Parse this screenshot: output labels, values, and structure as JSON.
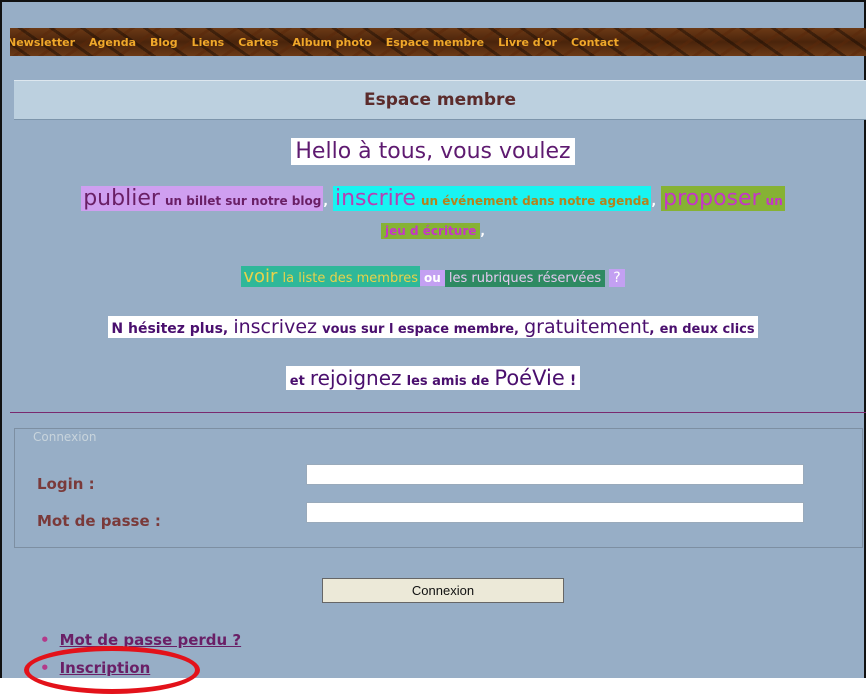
{
  "nav": {
    "items": [
      "Newsletter",
      "Agenda",
      "Blog",
      "Liens",
      "Cartes",
      "Album photo",
      "Espace membre",
      "Livre d'or",
      "Contact"
    ]
  },
  "page_title": "Espace membre",
  "intro": {
    "line1": "Hello à tous,  vous voulez",
    "line2": {
      "publier": "publier",
      "publier_rest": "un billet sur notre blog",
      "sep1": ",",
      "inscrire": "inscrire",
      "inscrire_rest": "un événement dans notre agenda",
      "sep2": ",",
      "proposer": "proposer",
      "proposer_rest": "un",
      "jeu": "jeu d écriture",
      "sep3": ","
    },
    "line3": {
      "voir": "voir",
      "voir_rest": "la liste des membres",
      "ou": "ou",
      "rubriques": "les rubriques réservées",
      "q": "?"
    },
    "line4": {
      "a": "N hésitez plus,",
      "b": "inscrivez",
      "c": "vous sur l espace membre,",
      "d": "gratuitement",
      "e": ",",
      "f": "en deux clics"
    },
    "line5": {
      "a": "et",
      "b": "rejoignez",
      "c": "les amis de",
      "d": "PoéVie",
      "e": "!"
    }
  },
  "login_form": {
    "legend": "Connexion",
    "login_label": "Login :",
    "login_value": "",
    "password_label": "Mot de passe :",
    "password_value": "",
    "submit_label": "Connexion"
  },
  "links": {
    "lost_password": "Mot de passe perdu ?",
    "register": "Inscription"
  },
  "colors": {
    "background": "#97aec6",
    "accent_purple": "#6a1f66",
    "highlight_red": "#e3121a"
  }
}
